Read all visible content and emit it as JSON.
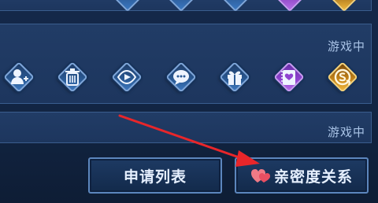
{
  "friends": [
    {
      "status": "游戏中"
    },
    {
      "status": "游戏中"
    }
  ],
  "action_icons": [
    {
      "name": "add-friend-icon"
    },
    {
      "name": "delete-icon"
    },
    {
      "name": "watch-icon"
    },
    {
      "name": "chat-icon"
    },
    {
      "name": "gift-icon"
    },
    {
      "name": "intimacy-book-icon"
    },
    {
      "name": "coin-exchange-icon"
    }
  ],
  "buttons": {
    "apply_list": "申请列表",
    "intimacy": "亲密度关系"
  },
  "colors": {
    "arrow": "#e8262a",
    "panel": "#1f3961",
    "accent_blue": "#3d78bf",
    "purple": "#8f43d0",
    "gold": "#e0a12a"
  }
}
